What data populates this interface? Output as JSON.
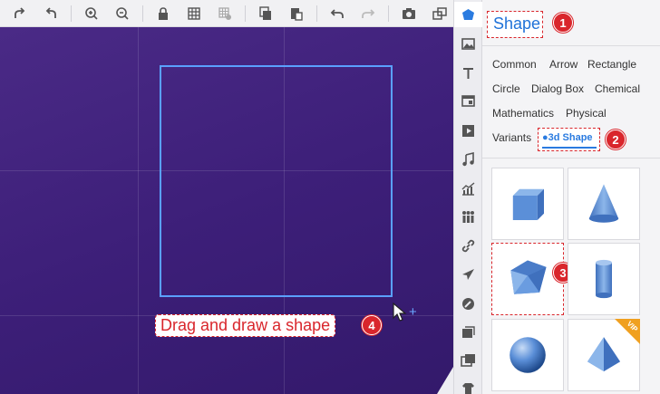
{
  "panel": {
    "title": "Shape",
    "categories": [
      "Common",
      "Arrow",
      "Rectangle",
      "Circle",
      "Dialog Box",
      "Chemical",
      "Mathematics",
      "Physical",
      "Variants"
    ],
    "active_category": "●3d Shape"
  },
  "canvas": {
    "hint": "Drag and draw a shape"
  },
  "badges": [
    "1",
    "2",
    "3",
    "4"
  ],
  "vip_label": "VIP",
  "colors": {
    "canvas_bg": "#3d1f79",
    "accent": "#2a7be0",
    "callout": "#d9262c",
    "shape_blue": "#5b8fd8"
  }
}
